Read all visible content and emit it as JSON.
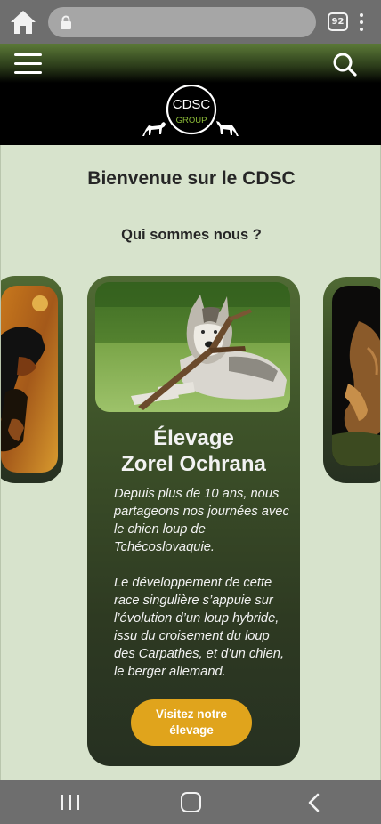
{
  "browser": {
    "tab_count": "92",
    "url": ""
  },
  "header": {
    "logo_text": "CDSC",
    "logo_subtext": "GROUP"
  },
  "main": {
    "title": "Bienvenue sur le CDSC",
    "subtitle": "Qui sommes nous ?"
  },
  "featured_card": {
    "title_line1": "Élevage",
    "title_line2": "Zorel Ochrana",
    "paragraph1": "Depuis plus de 10 ans, nous partageons nos journées avec le chien loup de Tchécoslovaquie.",
    "paragraph2": "Le développement de cette race singulière s’appuie sur l’évolution d’un loup hybride, issu du croisement du loup des Carpathes, et d’un chien, le berger allemand.",
    "button_label": "Visitez notre élevage"
  },
  "icons": {
    "home": "home-icon",
    "lock": "lock-icon",
    "menu": "hamburger-menu-icon",
    "search": "search-icon",
    "recents": "recent-apps-icon",
    "nav_home": "nav-home-icon",
    "back": "back-chevron-icon"
  },
  "colors": {
    "accent": "#e0a41c",
    "card_green": "#3e5329",
    "page_background": "#d7e3cc",
    "header_black": "#000000"
  }
}
